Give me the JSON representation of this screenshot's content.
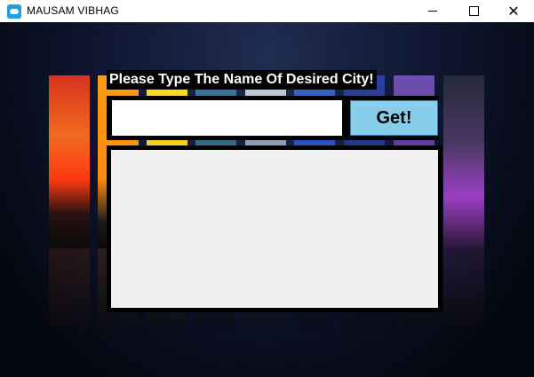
{
  "window": {
    "title": "MAUSAM VIBHAG",
    "controls": {
      "minimize": "minimize",
      "maximize": "maximize",
      "close": "✕"
    }
  },
  "form": {
    "prompt": "Please Type The Name Of Desired City!",
    "city_input_value": "",
    "get_button_label": "Get!"
  },
  "result": {
    "text": ""
  },
  "colors": {
    "button_bg": "#87ceeb",
    "result_bg": "#f0f0f0",
    "frame": "#000000",
    "prompt_text": "#ffffff"
  }
}
